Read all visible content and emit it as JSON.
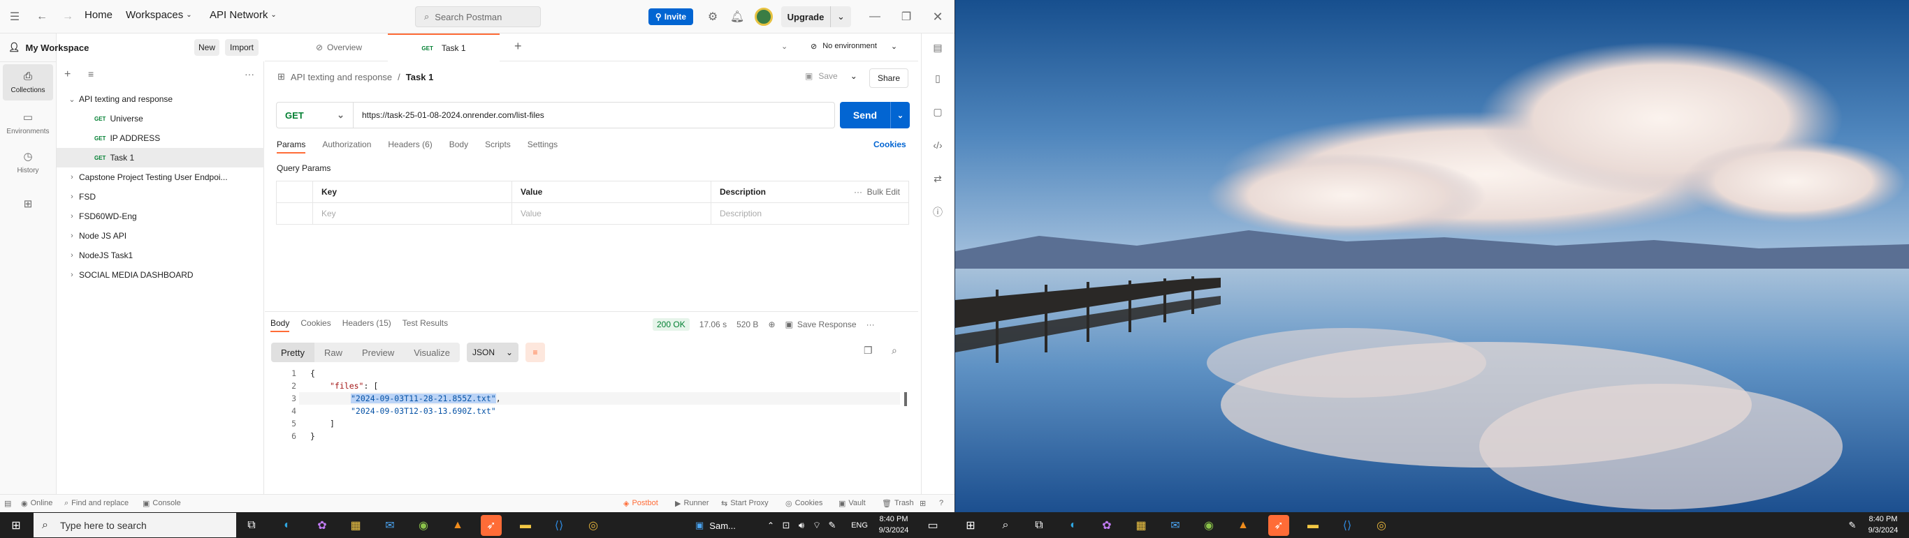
{
  "topbar": {
    "home": "Home",
    "workspaces": "Workspaces",
    "api_network": "API Network",
    "search_placeholder": "Search Postman",
    "invite": "Invite",
    "upgrade": "Upgrade"
  },
  "workspace": {
    "title": "My Workspace",
    "new_btn": "New",
    "import_btn": "Import"
  },
  "rail": {
    "items": [
      {
        "label": "Collections"
      },
      {
        "label": "Environments"
      },
      {
        "label": "History"
      }
    ]
  },
  "tree": {
    "items": [
      {
        "label": "API texting and response",
        "type": "folder-open"
      },
      {
        "label": "Universe",
        "method": "GET"
      },
      {
        "label": "IP ADDRESS",
        "method": "GET"
      },
      {
        "label": "Task 1",
        "method": "GET"
      },
      {
        "label": "Capstone Project Testing User Endpoi...",
        "type": "folder"
      },
      {
        "label": "FSD",
        "type": "folder"
      },
      {
        "label": "FSD60WD-Eng",
        "type": "folder"
      },
      {
        "label": "Node JS API",
        "type": "folder"
      },
      {
        "label": "NodeJS Task1",
        "type": "folder"
      },
      {
        "label": "SOCIAL MEDIA DASHBOARD",
        "type": "folder"
      }
    ]
  },
  "tabs": {
    "overview": "Overview",
    "task_method": "GET",
    "task": "Task 1",
    "environment": "No environment"
  },
  "request": {
    "crumb_parent": "API texting and response",
    "crumb_current": "Task 1",
    "save": "Save",
    "share": "Share",
    "method": "GET",
    "url": "https://task-25-01-08-2024.onrender.com/list-files",
    "send": "Send",
    "subtabs": [
      "Params",
      "Authorization",
      "Headers (6)",
      "Body",
      "Scripts",
      "Settings"
    ],
    "cookies": "Cookies",
    "query_title": "Query Params",
    "columns": [
      "Key",
      "Value",
      "Description"
    ],
    "bulk_edit": "Bulk Edit",
    "placeholders": [
      "Key",
      "Value",
      "Description"
    ]
  },
  "response": {
    "tabs": [
      "Body",
      "Cookies",
      "Headers (15)",
      "Test Results"
    ],
    "status": "200 OK",
    "time": "17.06 s",
    "size": "520 B",
    "save_response": "Save Response",
    "formats": [
      "Pretty",
      "Raw",
      "Preview",
      "Visualize"
    ],
    "type": "JSON",
    "lines": [
      "1",
      "2",
      "3",
      "4",
      "5",
      "6"
    ],
    "code": {
      "l1": "{",
      "l2_key": "\"files\"",
      "l2_rest": ": [",
      "l3": "\"2024-09-03T11-28-21.855Z.txt\"",
      "l3_tail": ",",
      "l4": "\"2024-09-03T12-03-13.690Z.txt\"",
      "l5": "]",
      "l6": "}"
    }
  },
  "statusbar": {
    "online": "Online",
    "find": "Find and replace",
    "console": "Console",
    "postbot": "Postbot",
    "runner": "Runner",
    "proxy": "Start Proxy",
    "cookies": "Cookies",
    "vault": "Vault",
    "trash": "Trash"
  },
  "taskbar": {
    "search_placeholder": "Type here to search",
    "samsung": "Sam...",
    "lang": "ENG",
    "time": "8:40 PM",
    "date": "9/3/2024"
  },
  "colors": {
    "accent": "#ff6c37",
    "primary": "#0265d2",
    "get": "#007f31"
  }
}
